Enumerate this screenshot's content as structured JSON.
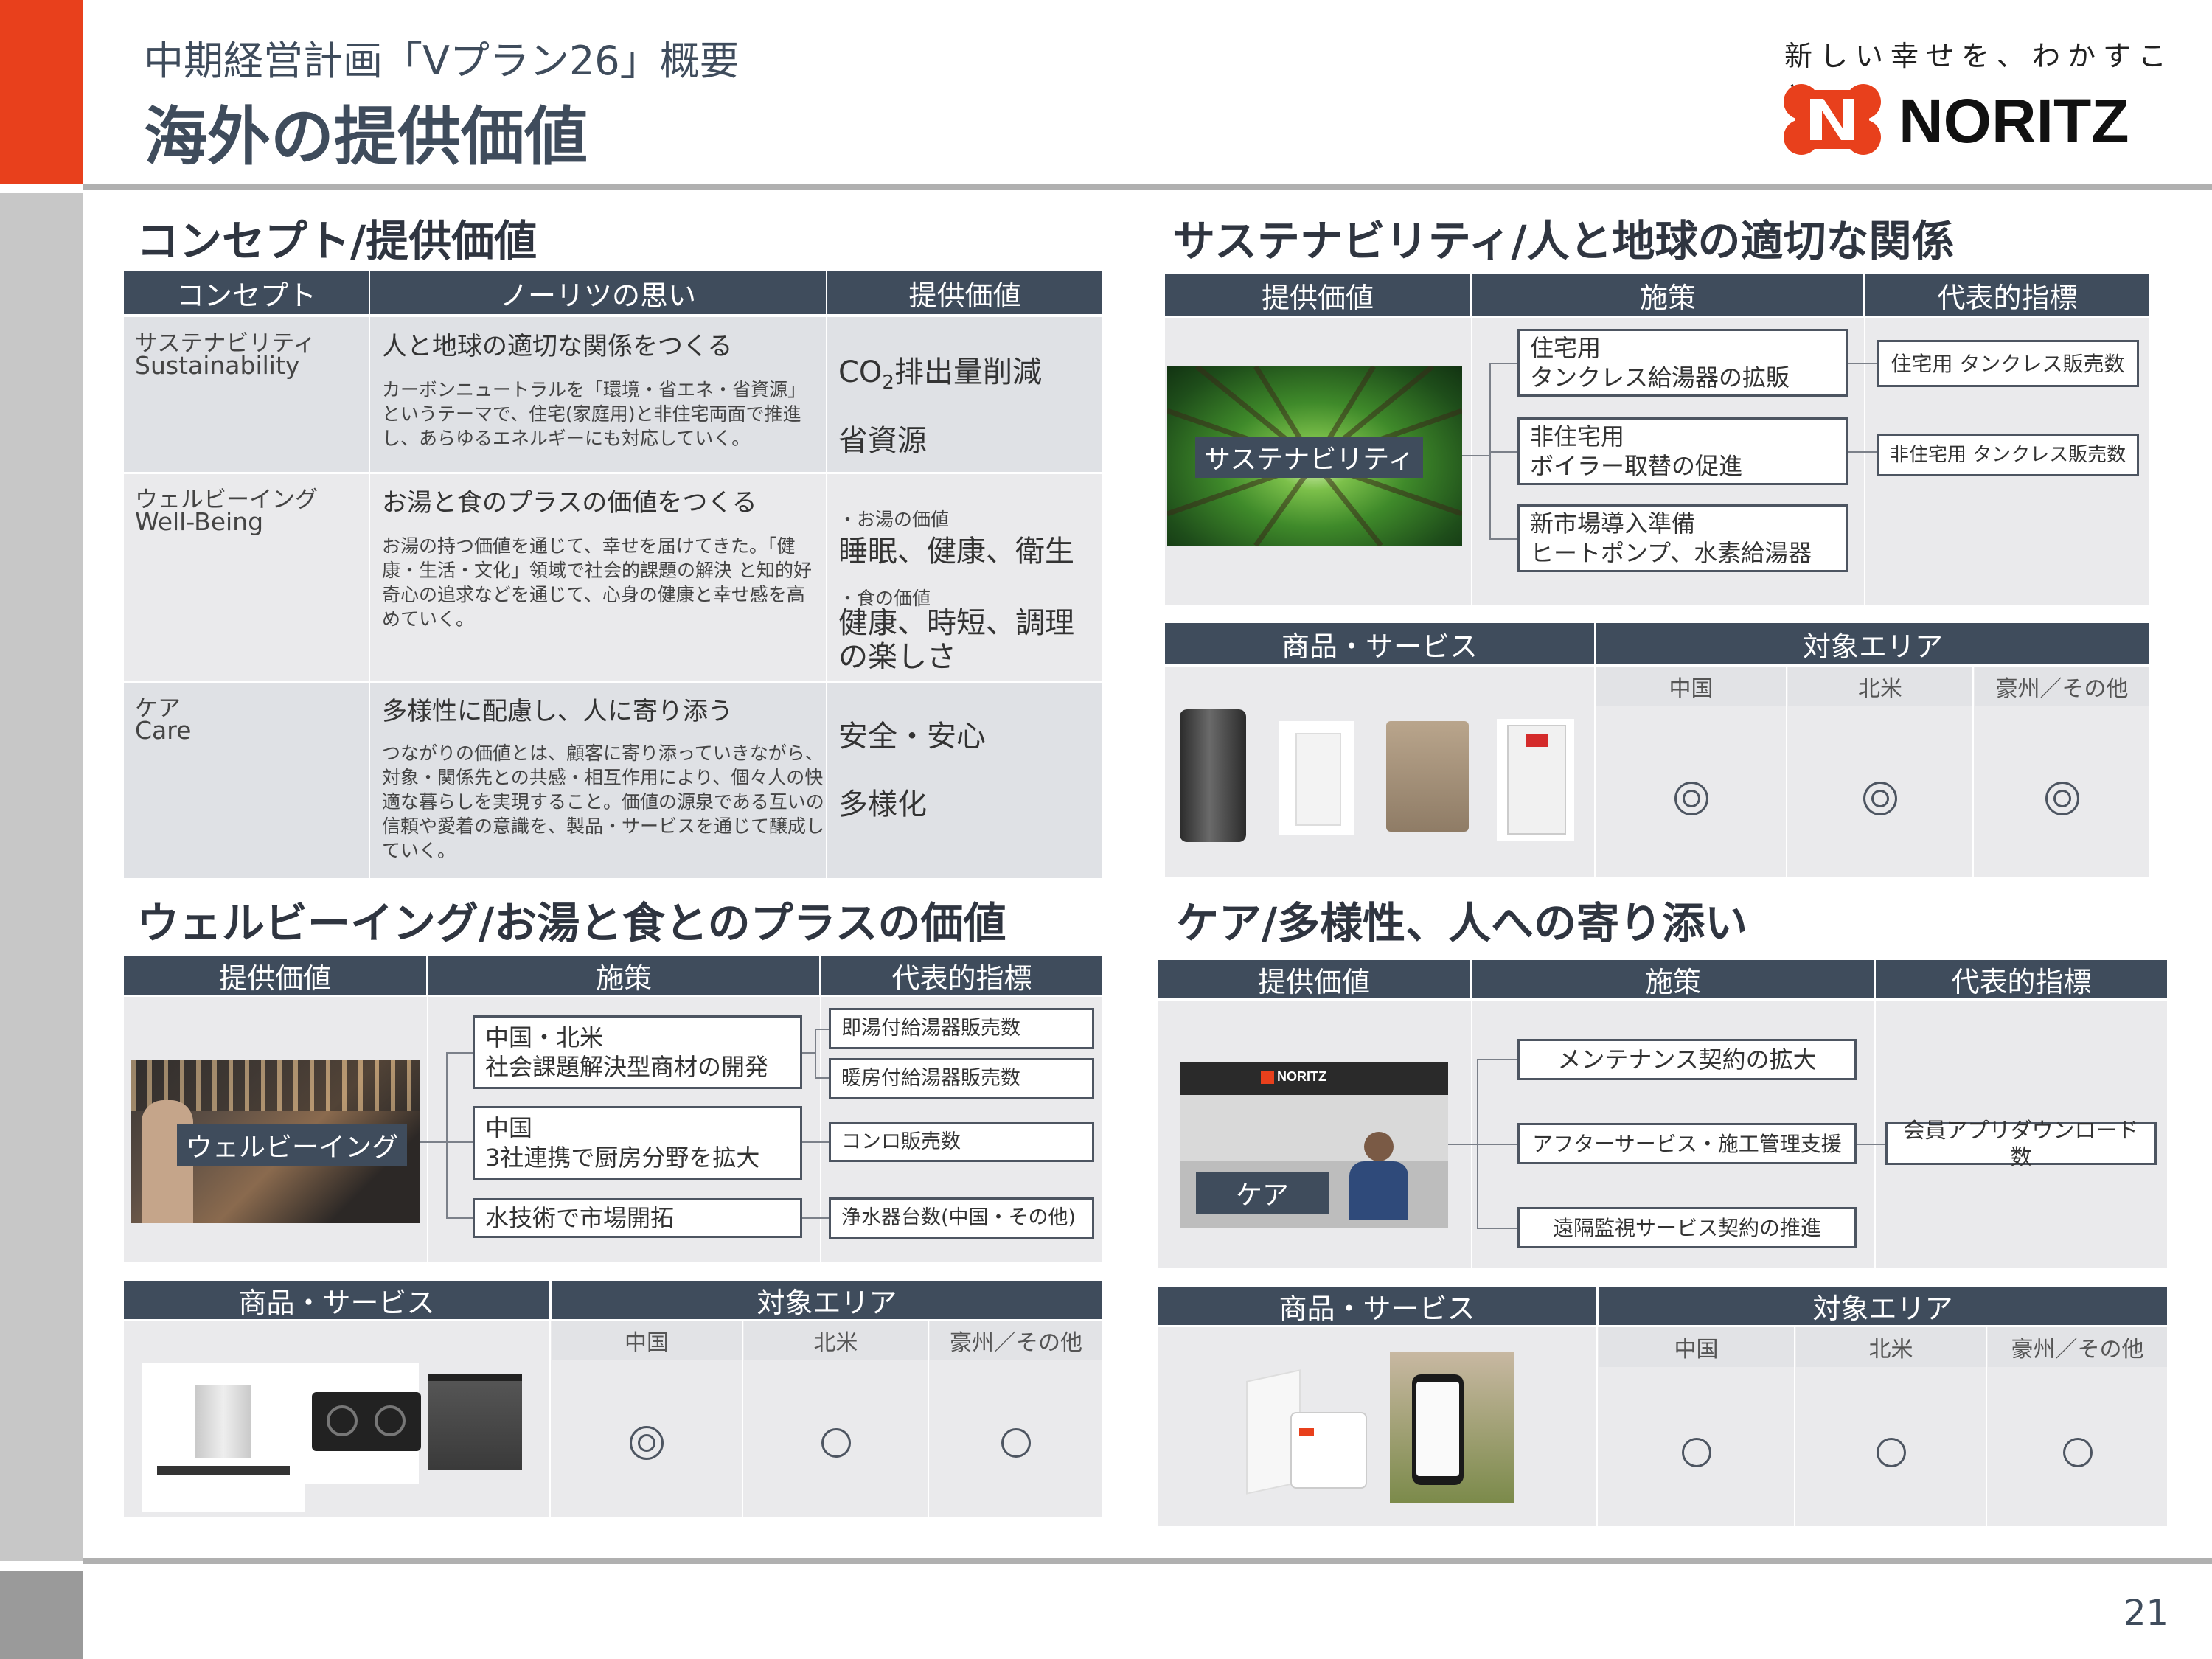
{
  "header": {
    "subtitle": "中期経営計画「Vプラン26」概要",
    "title": "海外の提供価値",
    "tagline": "新しい幸せを、わかすこと。",
    "logo_text": "NORITZ",
    "page_number": "21"
  },
  "colors": {
    "accent": "#e8401c",
    "header_bg": "#3f4c5c",
    "panel": "#eaeaec"
  },
  "concept": {
    "title": "コンセプト/提供価値",
    "headers": [
      "コンセプト",
      "ノーリツの思い",
      "提供価値"
    ],
    "rows": [
      {
        "concept_jp": "サステナビリティ",
        "concept_en": "Sustainability",
        "heading": "人と地球の適切な関係をつくる",
        "body": "カーボンニュートラルを「環境・省エネ・省資源」というテーマで、住宅(家庭用)と非住宅両面で推進し、あらゆるエネルギーにも対応していく。",
        "value_co": "CO",
        "value_sub": "2",
        "value_rest": "排出量削減",
        "value2": "省資源"
      },
      {
        "concept_jp": "ウェルビーイング",
        "concept_en": "Well-Being",
        "heading": "お湯と食のプラスの価値をつくる",
        "body": "お湯の持つ価値を通じて、幸せを届けてきた。「健康・生活・文化」領域で社会的課題の解決 と知的好奇心の追求などを通じて、心身の健康と幸せ感を高めていく。",
        "value_label1": "・お湯の価値",
        "value1": "睡眠、健康、衛生",
        "value_label2": "・食の価値",
        "value2": "健康、時短、調理の楽しさ"
      },
      {
        "concept_jp": "ケア",
        "concept_en": "Care",
        "heading": "多様性に配慮し、人に寄り添う",
        "body": "つながりの価値とは、顧客に寄り添っていきながら、対象・関係先との共感・相互作用により、個々人の快適な暮らしを実現すること。価値の源泉である互いの信頼や愛着の意識を、製品・サービスを通じて醸成していく。",
        "value1": "安全・安心",
        "value2": "多様化"
      }
    ]
  },
  "sustain": {
    "title": "サステナビリティ/人と地球の適切な関係",
    "headers": [
      "提供価値",
      "施策",
      "代表的指標"
    ],
    "image_label": "サステナビリティ",
    "measures": [
      "住宅用\nタンクレス給湯器の拡販",
      "非住宅用\nボイラー取替の促進",
      "新市場導入準備\nヒートポンプ、水素給湯器"
    ],
    "kpis": [
      "住宅用 タンクレス販売数",
      "非住宅用 タンクレス販売数"
    ],
    "product_header": "商品・サービス",
    "area_header": "対象エリア",
    "areas": [
      "中国",
      "北米",
      "豪州／その他"
    ],
    "marks": [
      "◎",
      "◎",
      "◎"
    ]
  },
  "wellbeing": {
    "title": "ウェルビーイング/お湯と食とのプラスの価値",
    "headers": [
      "提供価値",
      "施策",
      "代表的指標"
    ],
    "image_label": "ウェルビーイング",
    "measures": [
      "中国・北米\n社会課題解決型商材の開発",
      "中国\n3社連携で厨房分野を拡大",
      "水技術で市場開拓"
    ],
    "kpis": [
      "即湯付給湯器販売数",
      "暖房付給湯器販売数",
      "コンロ販売数",
      "浄水器台数(中国・その他)"
    ],
    "product_header": "商品・サービス",
    "area_header": "対象エリア",
    "areas": [
      "中国",
      "北米",
      "豪州／その他"
    ],
    "marks": [
      "◎",
      "○",
      "○"
    ]
  },
  "care": {
    "title": "ケア/多様性、人への寄り添い",
    "headers": [
      "提供価値",
      "施策",
      "代表的指標"
    ],
    "image_label": "ケア",
    "image_logo": "NORITZ",
    "measures": [
      "メンテナンス契約の拡大",
      "アフターサービス・施工管理支援",
      "遠隔監視サービス契約の推進"
    ],
    "kpis": [
      "会員アプリダウンロード数"
    ],
    "product_header": "商品・サービス",
    "area_header": "対象エリア",
    "areas": [
      "中国",
      "北米",
      "豪州／その他"
    ],
    "marks": [
      "○",
      "○",
      "○"
    ]
  }
}
